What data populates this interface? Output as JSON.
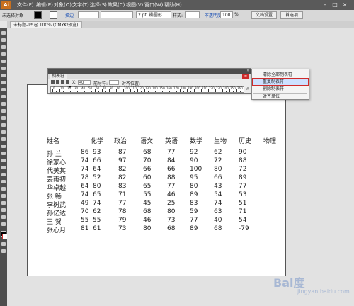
{
  "app": {
    "logo": "Ai"
  },
  "menu": [
    "文件(F)",
    "编辑(E)",
    "对象(O)",
    "文字(T)",
    "选择(S)",
    "效果(C)",
    "视图(V)",
    "窗口(W)",
    "帮助(H)"
  ],
  "window_controls": [
    "–",
    "□",
    "×"
  ],
  "control_bar": {
    "selection": "未选择对象",
    "stroke_label": "描边",
    "stroke_weight": "2 pt. 椭圆形",
    "style_label": "样式:",
    "opacity_label": "不透明度",
    "opacity_value": "100",
    "percent": "%",
    "doc_setup": "文档设置",
    "preferences": "首选项"
  },
  "document_tab": "未标题-1* @ 100% (CMYK/预览)",
  "tabs_panel": {
    "title": "制表符",
    "x_field": "40 mm",
    "leader_label": "前导符:",
    "align_label": "对齐位置:",
    "ruler_ticks": [
      "0",
      "10",
      "20",
      "30",
      "40",
      "50",
      "60",
      "70",
      "80",
      "90",
      "100",
      "110",
      "120",
      "130",
      "140",
      "150",
      "160",
      "170",
      "180",
      "190",
      "200",
      "210",
      "220",
      "230",
      "240",
      "250",
      "260"
    ]
  },
  "flyout_menu": {
    "items": [
      "清除全部制表符",
      "重复制表符",
      "删除制表符",
      "对齐单位"
    ],
    "highlighted": 1
  },
  "table": {
    "headers": [
      "姓名",
      "化学",
      "政治",
      "语文",
      "英语",
      "数学",
      "生物",
      "历史",
      "物理"
    ],
    "rows": [
      [
        "孙  兰",
        "86",
        "93",
        "87",
        "68",
        "77",
        "92",
        "62",
        "90"
      ],
      [
        "徐家心",
        "74",
        "66",
        "97",
        "70",
        "84",
        "90",
        "72",
        "88"
      ],
      [
        "代美其",
        "74",
        "64",
        "82",
        "66",
        "66",
        "100",
        "80",
        "72"
      ],
      [
        "姜雨初",
        "78",
        "52",
        "82",
        "60",
        "88",
        "95",
        "66",
        "89"
      ],
      [
        "华卓越",
        "64",
        "80",
        "83",
        "65",
        "77",
        "80",
        "43",
        "77"
      ],
      [
        "张  畅",
        "74",
        "65",
        "71",
        "55",
        "46",
        "89",
        "54",
        "53"
      ],
      [
        "李树武",
        "49",
        "74",
        "77",
        "45",
        "25",
        "83",
        "74",
        "51"
      ],
      [
        "孙亿达",
        "70",
        "62",
        "78",
        "68",
        "80",
        "59",
        "63",
        "71"
      ],
      [
        "王  贺",
        "55",
        "55",
        "79",
        "46",
        "73",
        "77",
        "40",
        "54"
      ],
      [
        "张心月",
        "81",
        "61",
        "73",
        "80",
        "68",
        "89",
        "68",
        "-79"
      ]
    ]
  },
  "watermark": {
    "text": "Bai度",
    "sub": "jingyan.baidu.com"
  },
  "colors": {
    "menubar": "#5a5a5a",
    "highlight_border": "#d02b2b",
    "menu_button": "#cc2a2a"
  }
}
